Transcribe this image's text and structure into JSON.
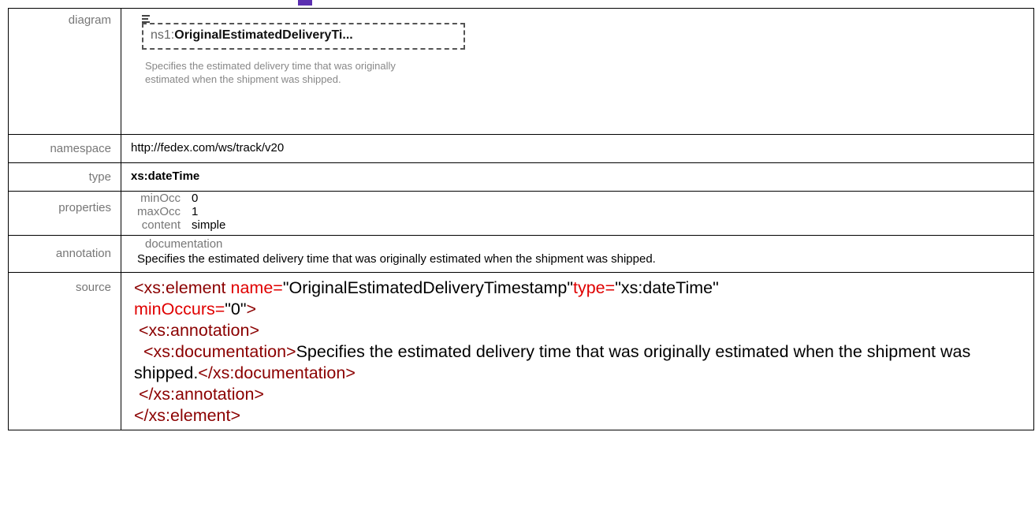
{
  "accent": "#5b2fb0",
  "rows": {
    "diagram": {
      "label": "diagram",
      "element_prefix": "ns1:",
      "element_name": "OriginalEstimatedDeliveryTi...",
      "description": "Specifies the estimated delivery time that was originally estimated when the shipment was shipped."
    },
    "namespace": {
      "label": "namespace",
      "value": "http://fedex.com/ws/track/v20"
    },
    "type": {
      "label": "type",
      "value": "xs:dateTime"
    },
    "properties": {
      "label": "properties",
      "items": [
        {
          "key": "minOcc",
          "value": "0"
        },
        {
          "key": "maxOcc",
          "value": "1"
        },
        {
          "key": "content",
          "value": "simple"
        }
      ]
    },
    "annotation": {
      "label": "annotation",
      "heading": "documentation",
      "text": "Specifies the estimated delivery time that was originally  estimated when the shipment was shipped."
    },
    "source": {
      "label": "source",
      "open_tag": "<xs:element",
      "attr1_name": "name=",
      "attr1_value": "\"OriginalEstimatedDeliveryTimestamp\"",
      "attr2_name": "type=",
      "attr2_value": "\"xs:dateTime\"",
      "attr3_name": "minOccurs=",
      "attr3_value": "\"0\"",
      "gt": ">",
      "annotation_open": "<xs:annotation>",
      "documentation_open": "<xs:documentation>",
      "documentation_text": "Specifies the estimated delivery time that was originally estimated when the shipment was shipped.",
      "documentation_close": "</xs:documentation>",
      "annotation_close": "</xs:annotation>",
      "element_close": "</xs:element>"
    }
  }
}
